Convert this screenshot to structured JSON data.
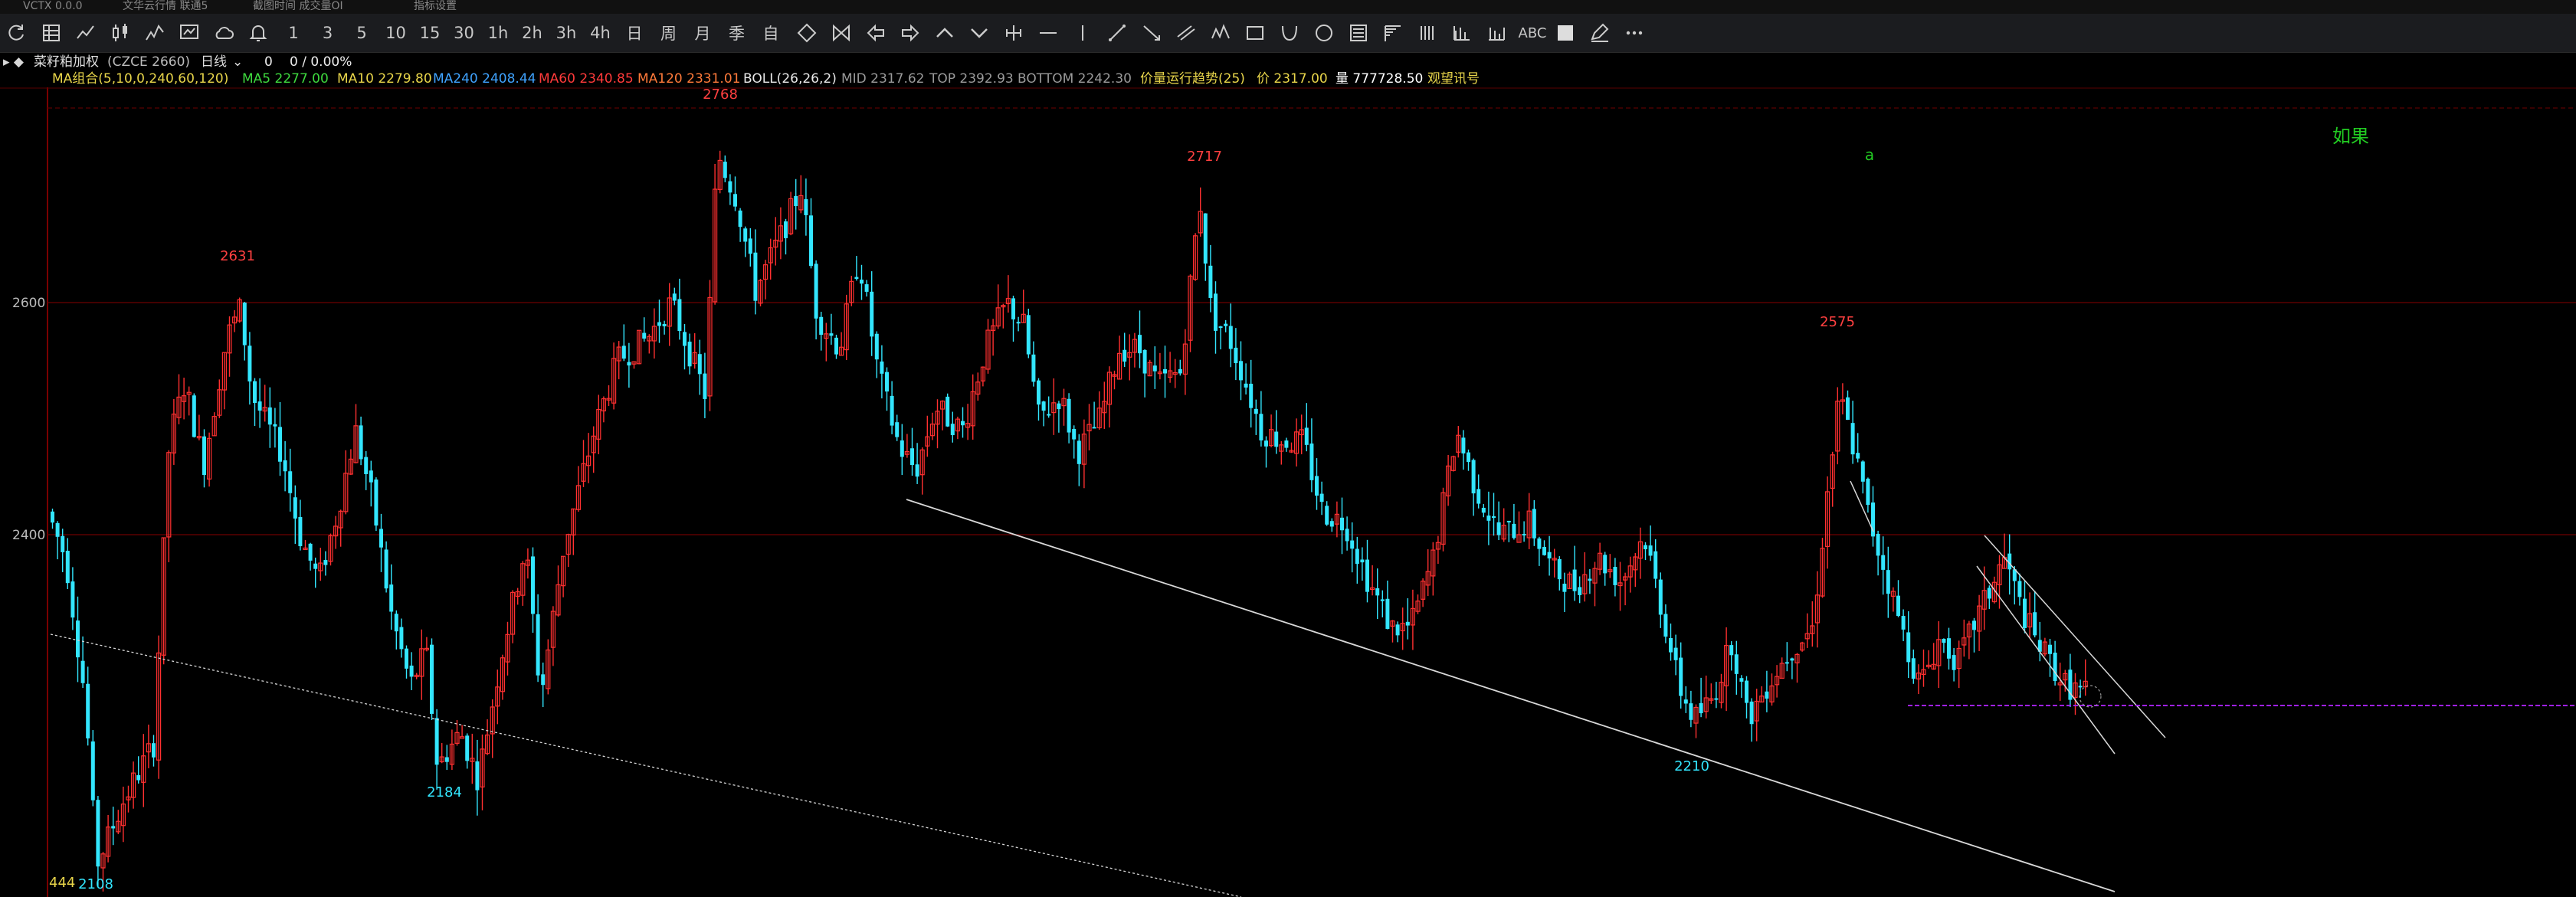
{
  "top_strip": [
    "VCTX 0.0.0",
    "文华云行情 联通5",
    "截图时间 成交量OI",
    "指标设置"
  ],
  "toolbar": {
    "icons": [
      "refresh-icon",
      "table-icon",
      "line-chart-icon",
      "kline-icon",
      "tick-chart-icon",
      "monitor-icon",
      "cloud-icon",
      "alert-icon"
    ],
    "periods": [
      "1",
      "3",
      "5",
      "10",
      "15",
      "30",
      "1h",
      "2h",
      "3h",
      "4h",
      "日",
      "周",
      "月",
      "季",
      "自"
    ],
    "draw_tools": [
      "diamond-icon",
      "bowtie-icon",
      "left-arrow-icon",
      "right-arrow-icon",
      "up-chevron-icon",
      "down-chevron-icon",
      "split-icon",
      "hline-icon",
      "vline-icon",
      "trend-line-icon",
      "ray-icon",
      "parallel-icon",
      "wave-icon",
      "rect-icon",
      "arc-icon",
      "circle-icon",
      "fib-icon",
      "gann-icon",
      "vlines-icon",
      "bars-icon",
      "fan-icon",
      "text-icon",
      "fill-icon",
      "pen-icon",
      "more-icon"
    ],
    "text_tool": "ABC"
  },
  "info": {
    "instrument": "菜籽粕加权",
    "code": "(CZCE 2660)",
    "period": "日线",
    "change": "0",
    "change_pct": "0 / 0.00%"
  },
  "legend": [
    {
      "text": "MA组合(5,10,0,240,60,120)",
      "color": "#e8d54a"
    },
    {
      "text": "MA5 2277.00",
      "color": "#3ed93e"
    },
    {
      "text": "MA10 2279.80",
      "color": "#e8d54a"
    },
    {
      "text": "MA240 2408.44",
      "color": "#3fa3ff"
    },
    {
      "text": "MA60 2340.85",
      "color": "#ff3a3a"
    },
    {
      "text": "MA120 2331.01",
      "color": "#ff7a3a"
    },
    {
      "text": "BOLL(26,26,2)",
      "color": "#e8e8e8"
    },
    {
      "text": "MID 2317.62",
      "color": "#9a9a9a"
    },
    {
      "text": "TOP 2392.93",
      "color": "#9a9a9a"
    },
    {
      "text": "BOTTOM 2242.30",
      "color": "#9a9a9a"
    },
    {
      "text": "价量运行趋势(25)",
      "color": "#e8d54a"
    },
    {
      "text": "价 2317.00",
      "color": "#e8d54a"
    },
    {
      "text": "量 777728.50",
      "color": "#ffffff"
    },
    {
      "text": "观望讯号",
      "color": "#e8d54a"
    }
  ],
  "chart_data": {
    "type": "candlestick",
    "y_ticks": [
      "2600",
      "2400"
    ],
    "corner_label": "444",
    "colors": {
      "up": "#ff3030",
      "down": "#33e6ff",
      "grid": "#5a0000",
      "trend": "#d8d8d8",
      "support": "#a020ff"
    },
    "peaks": [
      {
        "label": "2768",
        "color": "#ff4040"
      },
      {
        "label": "2631",
        "color": "#ff4040"
      },
      {
        "label": "2717",
        "color": "#ff4040"
      },
      {
        "label": "2575",
        "color": "#ff4040"
      },
      {
        "label": "2108",
        "color": "#33e6ff"
      },
      {
        "label": "2184",
        "color": "#33e6ff"
      },
      {
        "label": "2210",
        "color": "#33e6ff"
      }
    ],
    "annotations": [
      {
        "text": "a",
        "color": "#22cc22"
      },
      {
        "text": "如果",
        "color": "#22cc22"
      }
    ]
  }
}
